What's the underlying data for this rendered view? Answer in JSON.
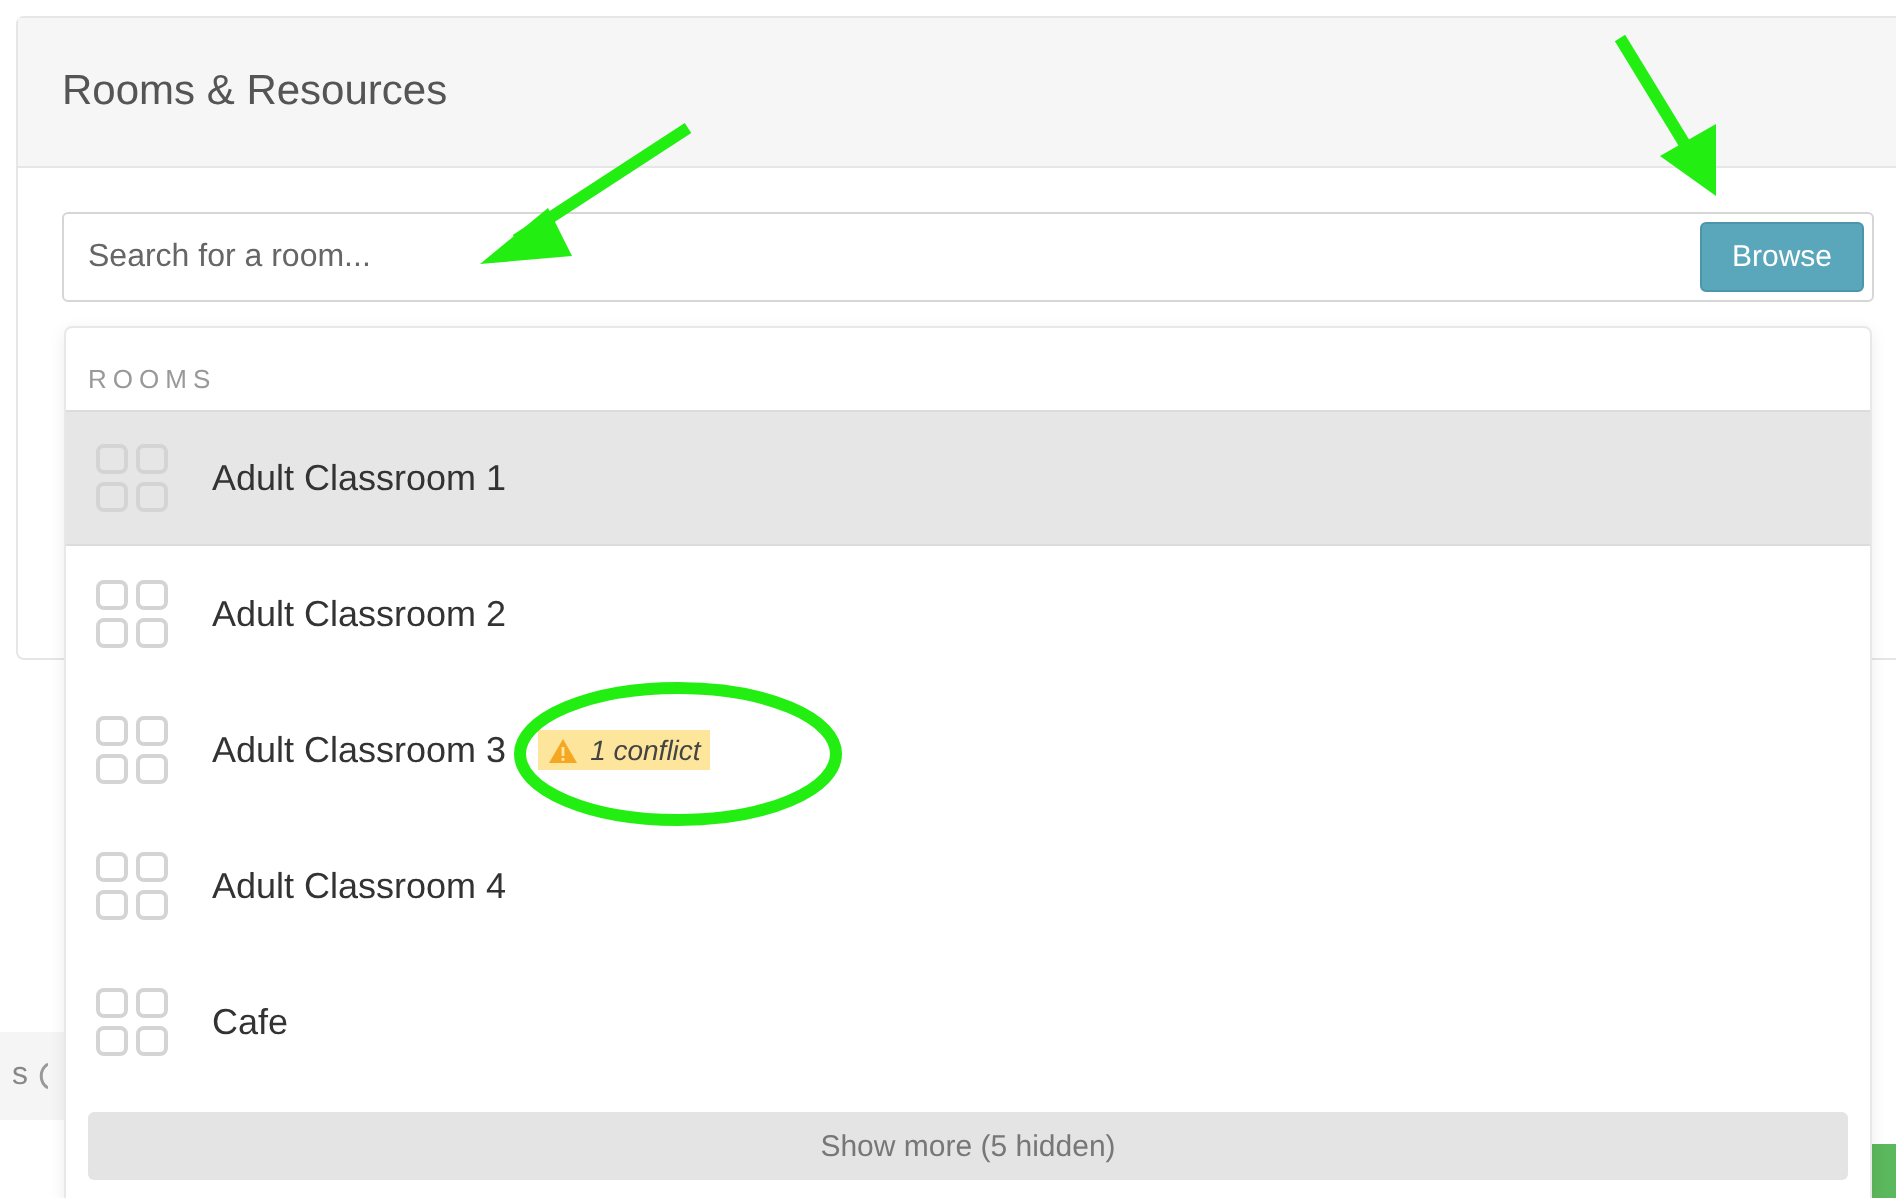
{
  "panel": {
    "title": "Rooms & Resources"
  },
  "search": {
    "placeholder": "Search for a room..."
  },
  "browse_button": {
    "label": "Browse"
  },
  "dropdown": {
    "section_label": "ROOMS",
    "rooms": [
      {
        "name": "Adult Classroom 1",
        "selected": true
      },
      {
        "name": "Adult Classroom 2",
        "selected": false
      },
      {
        "name": "Adult Classroom 3",
        "selected": false,
        "badge": "1 conflict"
      },
      {
        "name": "Adult Classroom 4",
        "selected": false
      },
      {
        "name": "Cafe",
        "selected": false
      }
    ],
    "show_more": "Show more (5 hidden)"
  },
  "background_fragment": {
    "text": "s"
  }
}
